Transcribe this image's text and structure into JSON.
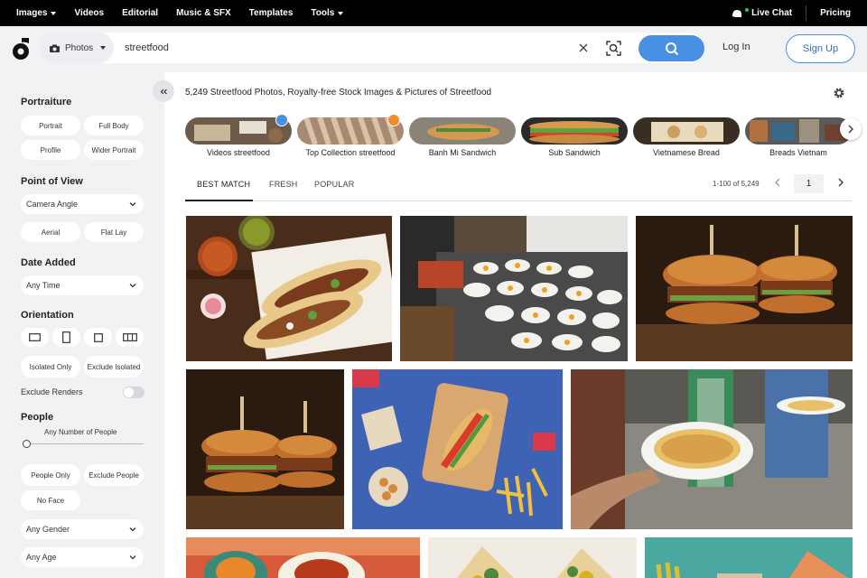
{
  "topnav": {
    "items": [
      "Images",
      "Videos",
      "Editorial",
      "Music & SFX",
      "Templates",
      "Tools"
    ],
    "live_chat": "Live Chat",
    "pricing": "Pricing"
  },
  "search": {
    "asset_type": "Photos",
    "query": "streetfood",
    "login": "Log In",
    "signup": "Sign Up"
  },
  "sidebar": {
    "portraiture": {
      "heading": "Portraiture",
      "options": [
        "Portrait",
        "Full Body",
        "Profile",
        "Wider Portrait"
      ]
    },
    "point_of_view": {
      "heading": "Point of View",
      "dropdown": "Camera Angle",
      "options": [
        "Aerial",
        "Flat Lay"
      ]
    },
    "date_added": {
      "heading": "Date Added",
      "dropdown": "Any Time"
    },
    "orientation": {
      "heading": "Orientation",
      "isolated_only": "Isolated Only",
      "exclude_isolated": "Exclude Isolated",
      "exclude_renders": "Exclude Renders"
    },
    "people": {
      "heading": "People",
      "slider_label": "Any Number of People",
      "people_only": "People Only",
      "exclude_people": "Exclude People",
      "no_face": "No Face",
      "gender": "Any Gender",
      "age": "Any Age"
    }
  },
  "results": {
    "title": "5,249 Streetfood Photos, Royalty-free Stock Images & Pictures of Streetfood",
    "chips": [
      "Videos streetfood",
      "Top Collection streetfood",
      "Banh Mi Sandwich",
      "Sub Sandwich",
      "Vietnamese Bread",
      "Breads Vietnam"
    ],
    "tabs": [
      "BEST MATCH",
      "FRESH",
      "POPULAR"
    ],
    "range": "1-100 of 5,249",
    "page": "1"
  },
  "colors": {
    "accent": "#4a90e2",
    "chip_video_badge": "#4a90e2",
    "chip_collection_badge": "#f08c2e"
  },
  "icons": [
    "logo-icon",
    "camera-icon",
    "chevron-down-icon",
    "close-icon",
    "visual-search-icon",
    "search-icon",
    "double-chevron-left-icon",
    "settings-gear-icon",
    "chevron-right-icon",
    "chevron-left-icon",
    "live-chat-icon"
  ]
}
